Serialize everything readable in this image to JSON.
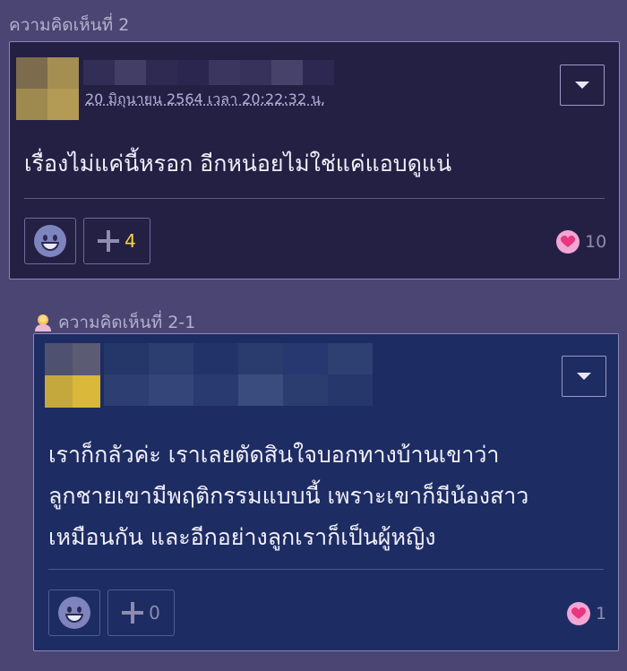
{
  "comment": {
    "label": "ความคิดเห็นที่ 2",
    "date": "20 มิถุนายน 2564 เวลา 20:22:32 น.",
    "text": "เรื่องไม่แค่นี้หรอก อีกหน่อยไม่ใช่แค่แอบดูแน่",
    "plus_count": "4",
    "like_count": "10"
  },
  "reply": {
    "label": "ความคิดเห็นที่ 2-1",
    "lines": [
      "เราก็กลัวค่ะ เราเลยตัดสินใจบอกทางบ้านเขาว่า",
      "ลูกชายเขามีพฤติกรรมแบบนี้ เพราะเขาก็มีน้องสาว",
      "เหมือนกัน และอีกอย่างลูกเราก็เป็นผู้หญิง"
    ],
    "plus_count": "0",
    "like_count": "1"
  },
  "colors": {
    "background": "#4a4572",
    "comment_card": "#242044",
    "reply_card": "#1d2c62",
    "plus_active": "#f5d547",
    "heart": "#f2a6d4"
  },
  "icons": {
    "menu": "chevron-down-icon",
    "emoji": "smiley-icon",
    "plus": "plus-icon",
    "like": "heart-icon",
    "member": "user-icon"
  }
}
